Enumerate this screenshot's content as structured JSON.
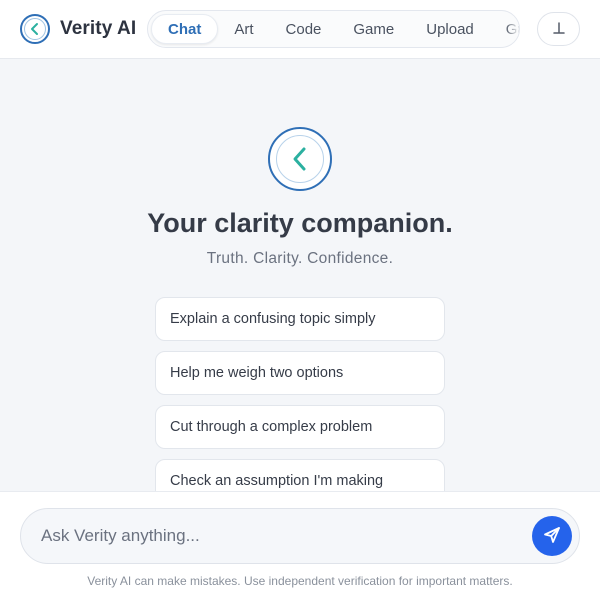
{
  "brand": {
    "name": "Verity AI",
    "logo_icon": "chevron-left-icon"
  },
  "nav": {
    "tabs": [
      {
        "label": "Chat",
        "active": true
      },
      {
        "label": "Art",
        "active": false
      },
      {
        "label": "Code",
        "active": false
      },
      {
        "label": "Game",
        "active": false
      },
      {
        "label": "Upload",
        "active": false
      },
      {
        "label": "Guide",
        "active": false
      }
    ],
    "action_icon": "up-tack-icon"
  },
  "hero": {
    "logo_icon": "chevron-left-icon",
    "title": "Your clarity companion.",
    "subtitle": "Truth. Clarity. Confidence."
  },
  "suggestions": [
    "Explain a confusing topic simply",
    "Help me weigh two options",
    "Cut through a complex problem",
    "Check an assumption I'm making"
  ],
  "composer": {
    "placeholder": "Ask Verity anything...",
    "value": "",
    "send_icon": "send-icon"
  },
  "disclaimer": "Verity AI can make mistakes. Use independent verification for important matters.",
  "colors": {
    "accent": "#2f6fb6",
    "send": "#2563eb",
    "logo_chevron": "#2bb0a0",
    "background": "#f4f6f9"
  }
}
